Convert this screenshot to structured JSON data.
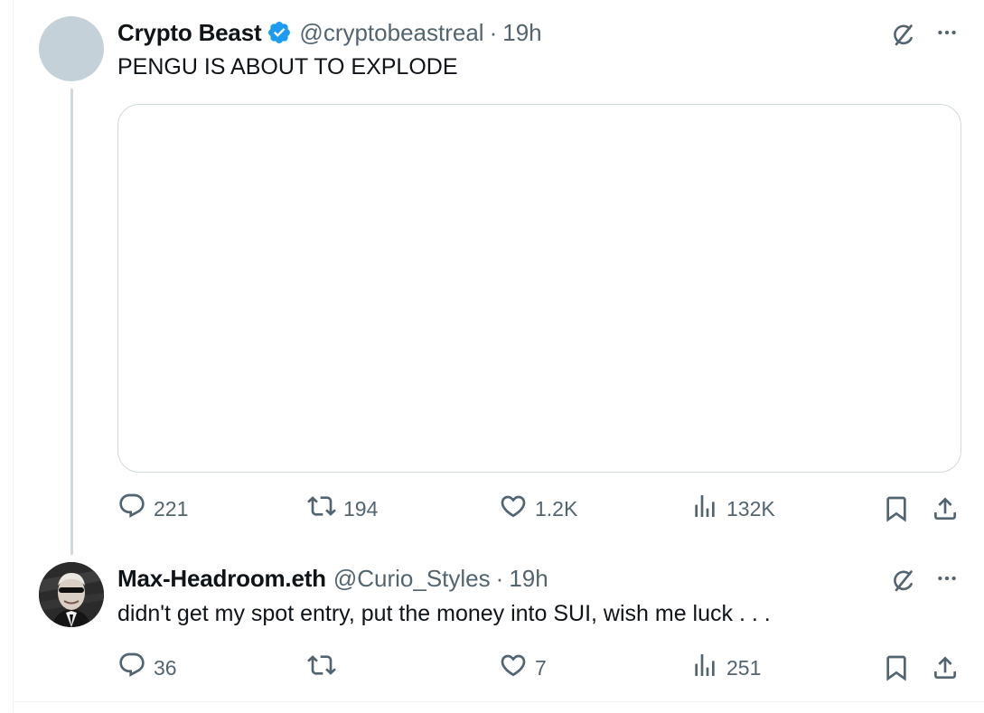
{
  "tweets": [
    {
      "name": "Crypto Beast",
      "verified": true,
      "handle": "@cryptobeastreal",
      "separator": "·",
      "time": "19h",
      "text": "PENGU IS ABOUT TO EXPLODE",
      "replies": "221",
      "retweets": "194",
      "likes": "1.2K",
      "views": "132K"
    },
    {
      "name": "Max-Headroom.eth",
      "verified": false,
      "handle": "@Curio_Styles",
      "separator": "·",
      "time": "19h",
      "text": "didn't get my spot entry, put the money into SUI, wish me luck . . .",
      "replies": "36",
      "retweets": "",
      "likes": "7",
      "views": "251"
    }
  ],
  "icons": {
    "grok": "grok-icon",
    "more": "more-options-icon",
    "reply": "reply-icon",
    "retweet": "retweet-icon",
    "like": "like-icon",
    "views": "views-icon",
    "bookmark": "bookmark-icon",
    "share": "share-icon",
    "verified": "verified-badge-icon"
  },
  "colors": {
    "text": "#0f1419",
    "secondary": "#536471",
    "verified": "#1d9bf0",
    "thread_line": "#cfd9de"
  }
}
